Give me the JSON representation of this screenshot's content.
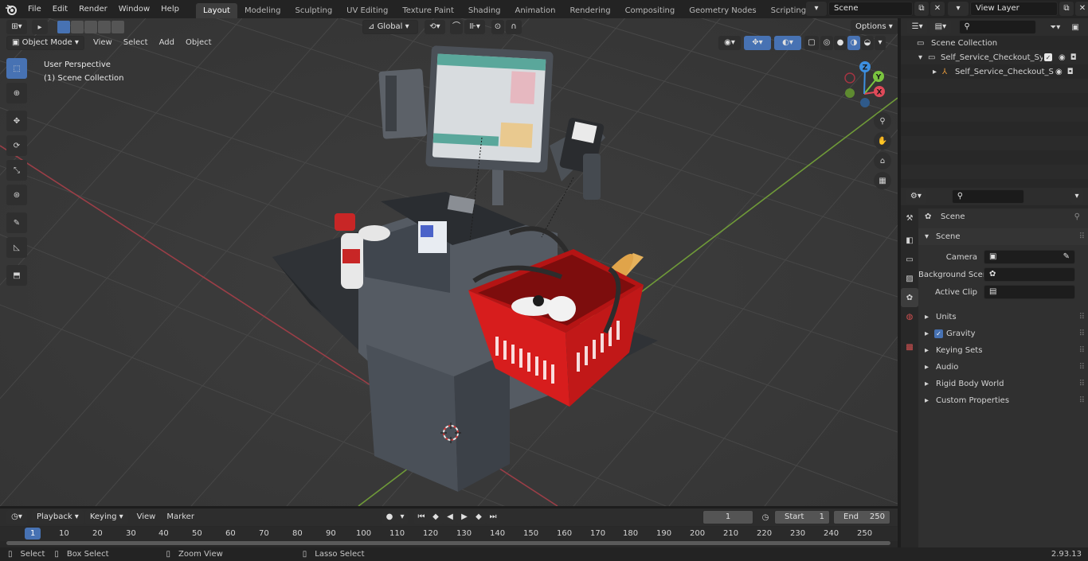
{
  "topbar": {
    "menus": [
      "File",
      "Edit",
      "Render",
      "Window",
      "Help"
    ],
    "workspaces": [
      "Layout",
      "Modeling",
      "Sculpting",
      "UV Editing",
      "Texture Paint",
      "Shading",
      "Animation",
      "Rendering",
      "Compositing",
      "Geometry Nodes",
      "Scripting"
    ],
    "active_workspace": "Layout",
    "add_tab": "+",
    "scene_name": "Scene",
    "view_layer_name": "View Layer"
  },
  "viewport": {
    "mode": "Object Mode",
    "menus": [
      "View",
      "Select",
      "Add",
      "Object"
    ],
    "transform_orientation": "Global",
    "options_label": "Options",
    "perspective_label": "User Perspective",
    "collection_label": "(1) Scene Collection",
    "gizmo": {
      "x": "X",
      "y": "Y",
      "z": "Z"
    }
  },
  "outliner": {
    "root": "Scene Collection",
    "items": [
      {
        "label": "Self_Service_Checkout_Syste"
      },
      {
        "label": "Self_Service_Checkout_S"
      }
    ]
  },
  "properties": {
    "context_title": "Scene",
    "section_scene": "Scene",
    "fields": [
      {
        "label": "Camera"
      },
      {
        "label": "Background Scene"
      },
      {
        "label": "Active Clip"
      }
    ],
    "panels": [
      "Units",
      "Gravity",
      "Keying Sets",
      "Audio",
      "Rigid Body World",
      "Custom Properties"
    ]
  },
  "timeline": {
    "menus": [
      "Playback",
      "Keying",
      "View",
      "Marker"
    ],
    "current_frame": "1",
    "start_label": "Start",
    "start_value": "1",
    "end_label": "End",
    "end_value": "250",
    "ruler": [
      "1",
      "10",
      "20",
      "30",
      "40",
      "50",
      "60",
      "70",
      "80",
      "90",
      "100",
      "110",
      "120",
      "130",
      "140",
      "150",
      "160",
      "170",
      "180",
      "190",
      "200",
      "210",
      "220",
      "230",
      "240",
      "250"
    ]
  },
  "status": {
    "select": "Select",
    "box_select": "Box Select",
    "zoom_view": "Zoom View",
    "lasso_select": "Lasso Select",
    "version": "2.93.13"
  },
  "colors": {
    "accent": "#4772b3",
    "x_axis": "#e04a59",
    "y_axis": "#7ac43f",
    "z_axis": "#3d8fe0",
    "basket": "#d51c1c"
  }
}
